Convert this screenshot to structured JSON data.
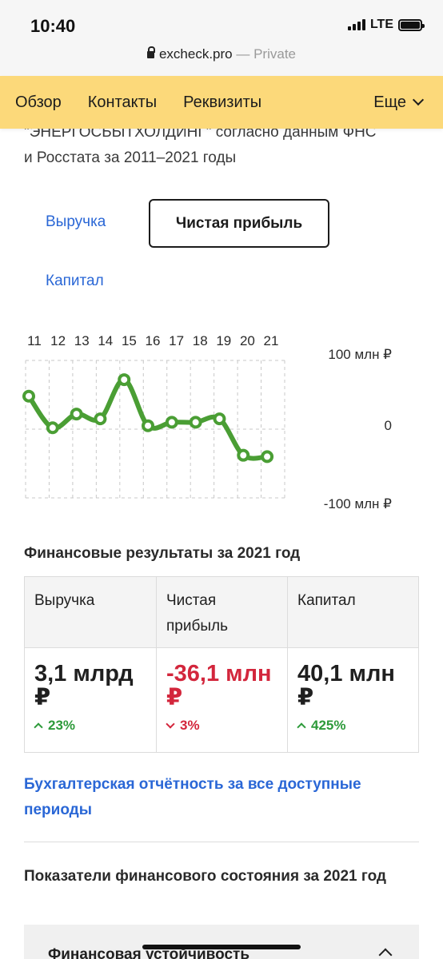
{
  "status": {
    "time": "10:40",
    "network": "LTE"
  },
  "browser": {
    "domain": "excheck.pro",
    "privacy": "— Private"
  },
  "nav": {
    "items": [
      "Обзор",
      "Контакты",
      "Реквизиты"
    ],
    "more": "Еще"
  },
  "intro": {
    "line1": "\"ЭНЕРГОСБЫТХОЛДИНГ\" согласно данным ФНС",
    "line2": "и Росстата за 2011–2021 годы"
  },
  "tabs": {
    "revenue": "Выручка",
    "net_profit": "Чистая прибыль",
    "capital": "Капитал",
    "active": "net_profit"
  },
  "chart_data": {
    "type": "line",
    "x": [
      "11",
      "12",
      "13",
      "14",
      "15",
      "16",
      "17",
      "18",
      "19",
      "20",
      "21"
    ],
    "series": [
      {
        "values": [
          48,
          2,
          22,
          15,
          72,
          5,
          10,
          10,
          15,
          -38,
          -40
        ]
      }
    ],
    "y_ticks": [
      "100 млн ₽",
      "0",
      "-100 млн ₽"
    ],
    "ylim": [
      -100,
      100
    ],
    "grid": true,
    "line_color": "#4a9e34"
  },
  "fin_results": {
    "title": "Финансовые результаты за 2021 год",
    "columns": [
      {
        "header": "Выручка",
        "value": "3,1 млрд ₽",
        "delta": "23%",
        "direction": "up"
      },
      {
        "header": "Чистая прибыль",
        "value": "-36,1 млн ₽",
        "delta": "3%",
        "direction": "down"
      },
      {
        "header": "Капитал",
        "value": "40,1 млн ₽",
        "delta": "425%",
        "direction": "up"
      }
    ]
  },
  "report_link": "Бухгалтерская отчётность за все доступные периоды",
  "financial_state": {
    "title": "Показатели финансового состояния за 2021 год",
    "accordion_label": "Финансовая устойчивость"
  },
  "colors": {
    "accent": "#2a67d6",
    "nav_bg": "#fcd97a",
    "positive": "#2d9a3a",
    "negative": "#d3263c"
  }
}
